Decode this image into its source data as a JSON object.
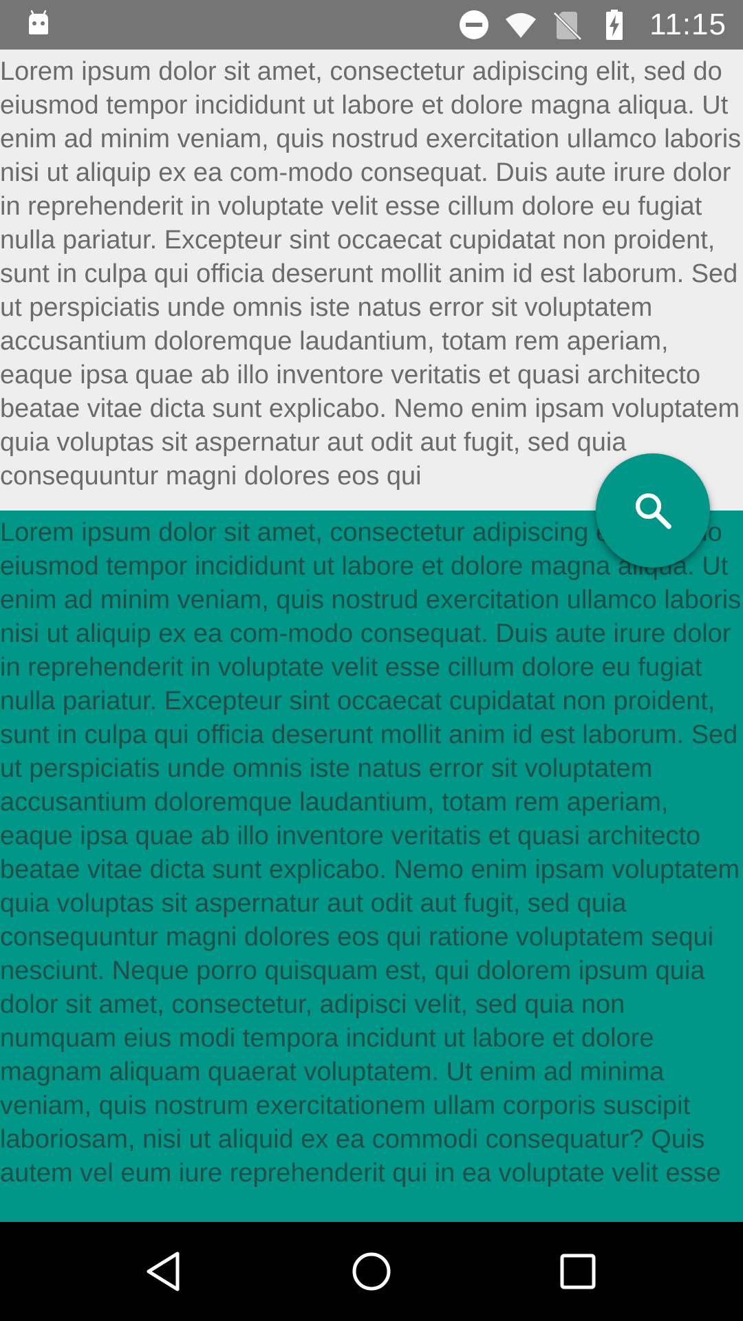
{
  "status_bar": {
    "time": "11:15",
    "icons": [
      "android-icon",
      "do-not-disturb-icon",
      "wifi-icon",
      "no-sim-icon",
      "battery-charging-icon"
    ]
  },
  "content": {
    "top_text": "Lorem ipsum dolor sit amet, consectetur adipiscing elit, sed do eiusmod tempor incididunt ut labore et dolore magna aliqua. Ut enim ad minim veniam, quis nostrud exercitation ullamco laboris nisi ut aliquip ex ea com-modo consequat. Duis aute irure dolor in reprehenderit in voluptate velit esse cillum dolore eu fugiat nulla pariatur. Excepteur sint occaecat cupidatat non proident, sunt in culpa qui officia deserunt mollit anim id est laborum. Sed ut perspiciatis unde omnis iste natus error sit voluptatem accusantium doloremque laudantium, totam rem aperiam, eaque ipsa quae ab illo inventore veritatis et quasi architecto beatae vitae dicta sunt explicabo. Nemo enim ipsam voluptatem quia voluptas sit aspernatur aut odit aut fugit, sed quia consequuntur magni dolores eos qui",
    "bottom_text": "Lorem ipsum dolor sit amet, consectetur adipiscing elit, sed do eiusmod tempor incididunt ut labore et dolore magna aliqua. Ut enim ad minim veniam, quis nostrud exercitation ullamco laboris nisi ut aliquip ex ea com-modo consequat. Duis aute irure dolor in reprehenderit in voluptate velit esse cillum dolore eu fugiat nulla pariatur. Excepteur sint occaecat cupidatat non proident, sunt in culpa qui officia deserunt mollit anim id est laborum. Sed ut perspiciatis unde omnis iste natus error sit voluptatem accusantium doloremque laudantium, totam rem aperiam, eaque ipsa quae ab illo inventore veritatis et quasi architecto beatae vitae dicta sunt explicabo. Nemo enim ipsam voluptatem quia voluptas sit aspernatur aut odit aut fugit, sed quia consequuntur magni dolores eos qui ratione voluptatem sequi nesciunt. Neque porro quisquam est, qui dolorem ipsum quia dolor sit amet, consectetur, adipisci velit, sed quia non numquam eius modi tempora incidunt ut labore et dolore magnam aliquam quaerat voluptatem. Ut enim ad minima veniam, quis nostrum exercitationem ullam corporis suscipit laboriosam, nisi ut aliquid ex ea commodi consequatur? Quis autem vel eum iure reprehenderit qui in ea voluptate velit esse"
  },
  "fab": {
    "icon": "search-icon"
  },
  "nav_bar": {
    "icons": [
      "back-icon",
      "home-icon",
      "recents-icon"
    ]
  },
  "colors": {
    "status_bar": "#757575",
    "top_panel": "#eeeeee",
    "accent": "#009688",
    "nav_bar": "#000000"
  }
}
